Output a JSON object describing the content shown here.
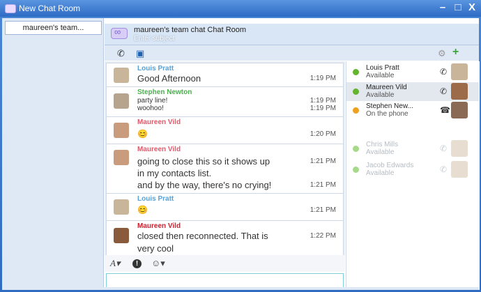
{
  "window": {
    "title": "New Chat Room",
    "minimize": "–",
    "close": "X"
  },
  "tabs": [
    {
      "label": "maureen's team..."
    }
  ],
  "room": {
    "name": "maureen's team chat Chat Room",
    "subject_placeholder": "Enter subject"
  },
  "toolbar": {
    "phone_icon": "phone-icon",
    "screen_icon": "screen-share-icon",
    "settings_icon": "gear-icon",
    "add_icon": "add-participant-icon"
  },
  "messages": [
    {
      "sender": "Louis Pratt",
      "color": "#5a9fd4",
      "lines": [
        "Good Afternoon"
      ],
      "times": [
        "1:19 PM"
      ]
    },
    {
      "sender": "Stephen Newton",
      "color": "#4caf50",
      "lines": [
        "party line!",
        "woohoo!"
      ],
      "times": [
        "1:19 PM",
        "1:19 PM"
      ]
    },
    {
      "sender": "Maureen Vild",
      "color": "#e05a6a",
      "lines": [
        "😊"
      ],
      "times": [
        "1:20 PM"
      ]
    },
    {
      "sender": "Maureen Vild",
      "color": "#e05a6a",
      "lines": [
        "going to close this so it shows up",
        "in my contacts list.",
        "and by the way, there's no crying!"
      ],
      "times": [
        "1:21 PM",
        "",
        "1:21 PM"
      ]
    },
    {
      "sender": "Louis Pratt",
      "color": "#5a9fd4",
      "lines": [
        "😊"
      ],
      "times": [
        "1:21 PM"
      ]
    },
    {
      "sender": "Maureen Vild",
      "color": "#cc1f2f",
      "lines": [
        "closed then reconnected. That is",
        "very cool"
      ],
      "times": [
        "1:22 PM",
        ""
      ]
    }
  ],
  "roster": [
    {
      "name": "Louis Pratt",
      "state": "Available",
      "status_color": "#62b52d"
    },
    {
      "name": "Maureen Vild",
      "state": "Available",
      "status_color": "#62b52d"
    },
    {
      "name": "Stephen New...",
      "state": "On the phone",
      "status_color": "#f0a020"
    },
    {
      "name": "Chris Mills",
      "state": "Available",
      "status_color": "#a7d98a"
    },
    {
      "name": "Jacob Edwards",
      "state": "Available",
      "status_color": "#a7d98a"
    }
  ],
  "input": {
    "format_label": "A▾",
    "alert_label": "!",
    "emoticon_label": "☺▾"
  }
}
